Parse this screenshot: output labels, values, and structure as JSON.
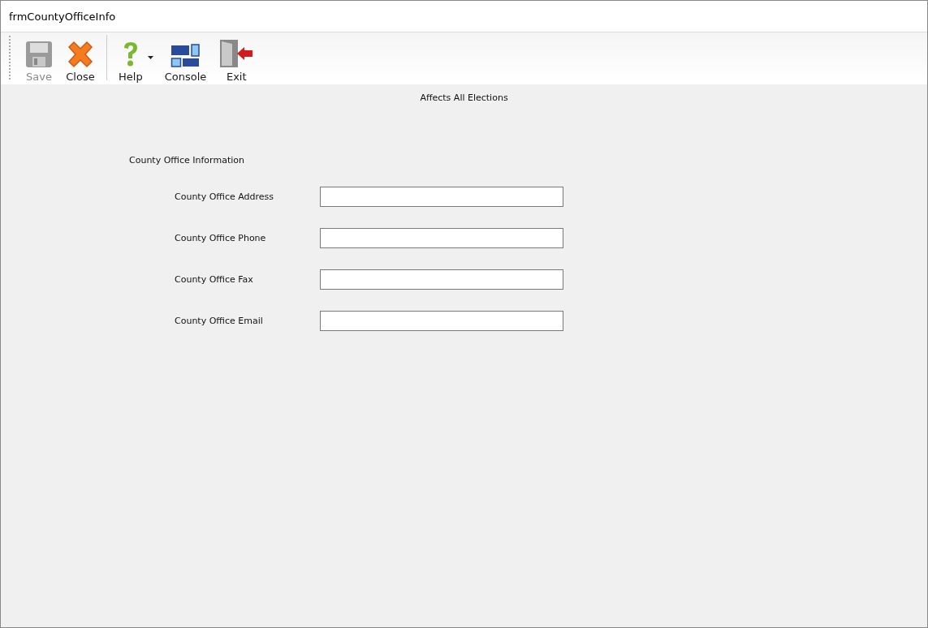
{
  "window": {
    "title": "frmCountyOfficeInfo"
  },
  "toolbar": [
    {
      "label": "Save",
      "kind": "button",
      "disabled": true
    },
    {
      "label": "Close",
      "kind": "button",
      "disabled": false
    },
    {
      "kind": "separator"
    },
    {
      "label": "Help",
      "kind": "dropdown",
      "disabled": false
    },
    {
      "label": "Console",
      "kind": "button",
      "disabled": false
    },
    {
      "label": "Exit",
      "kind": "button",
      "disabled": false
    }
  ],
  "notice": "Affects All Elections",
  "section": {
    "title": "County Office Information",
    "fields": [
      {
        "label": "County Office Address"
      },
      {
        "label": "County Office Phone"
      },
      {
        "label": "County Office Fax"
      },
      {
        "label": "County Office Email"
      }
    ]
  }
}
